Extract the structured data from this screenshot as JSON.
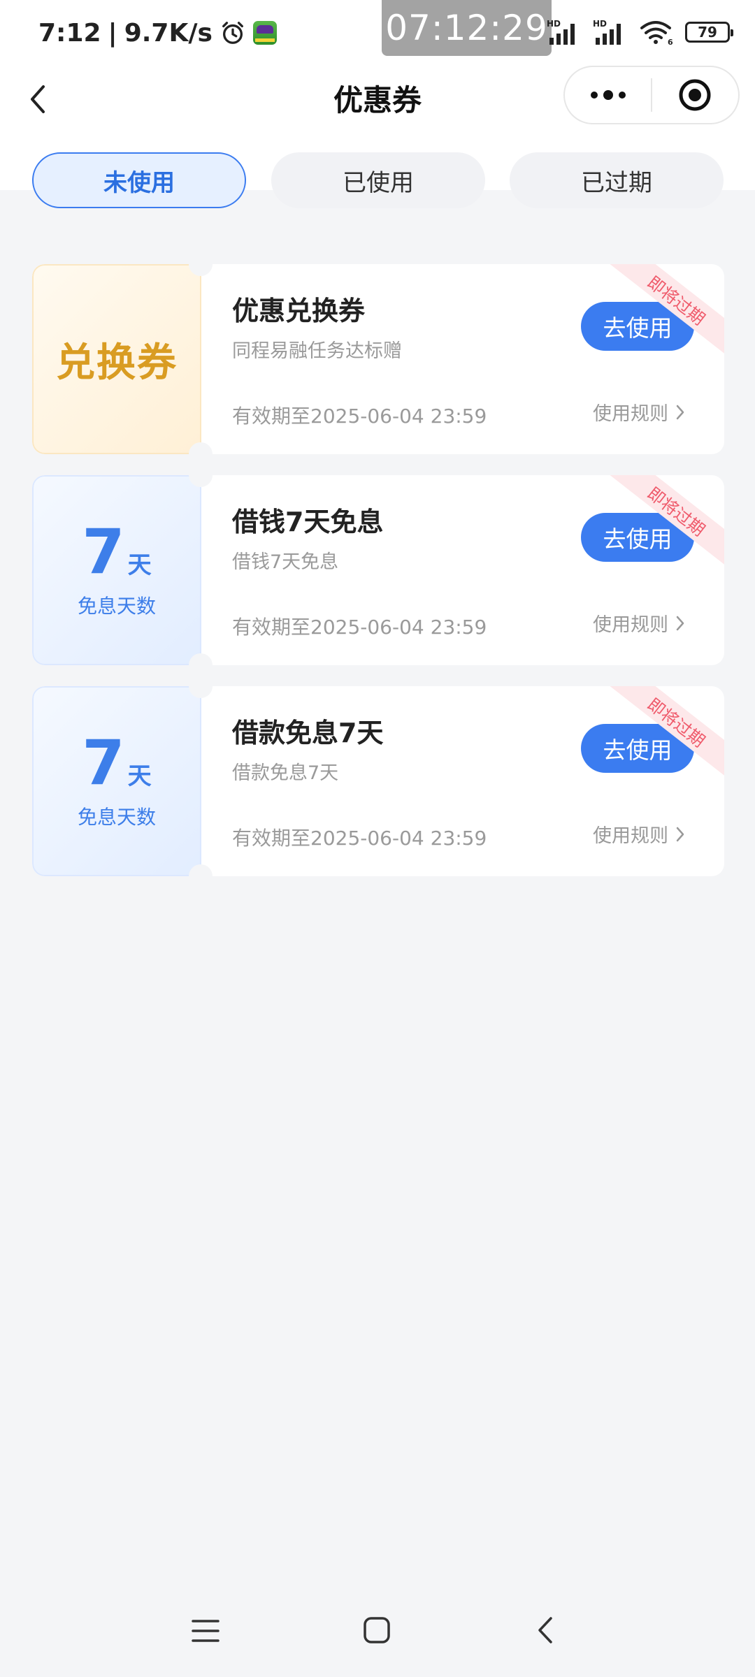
{
  "status_bar": {
    "time": "7:12",
    "network_speed": "9.7K/s",
    "clock_overlay": "07:12:29",
    "signal_label_1": "HD",
    "signal_label_2": "HD",
    "wifi_label": "6",
    "battery": "79"
  },
  "nav": {
    "title": "优惠券",
    "icons": {
      "back": "chevron-left-icon",
      "more": "more-dots-icon",
      "close": "target-icon"
    }
  },
  "tabs": [
    {
      "label": "未使用",
      "active": true
    },
    {
      "label": "已使用",
      "active": false
    },
    {
      "label": "已过期",
      "active": false
    }
  ],
  "coupons": [
    {
      "left_text": "兑换券",
      "title": "优惠兑换券",
      "subtitle": "同程易融任务达标赠",
      "validity": "有效期至2025-06-04 23:59",
      "button": "去使用",
      "rules": "使用规则",
      "ribbon": "即将过期"
    },
    {
      "days_num": "7",
      "days_unit": "天",
      "days_caption": "免息天数",
      "title": "借钱7天免息",
      "subtitle": "借钱7天免息",
      "validity": "有效期至2025-06-04 23:59",
      "button": "去使用",
      "rules": "使用规则",
      "ribbon": "即将过期"
    },
    {
      "days_num": "7",
      "days_unit": "天",
      "days_caption": "免息天数",
      "title": "借款免息7天",
      "subtitle": "借款免息7天",
      "validity": "有效期至2025-06-04 23:59",
      "button": "去使用",
      "rules": "使用规则",
      "ribbon": "即将过期"
    }
  ],
  "colors": {
    "primary": "#3b7cf0",
    "gold": "#d99c22",
    "ribbon_text": "#ef5a6b",
    "background": "#f4f5f7"
  }
}
